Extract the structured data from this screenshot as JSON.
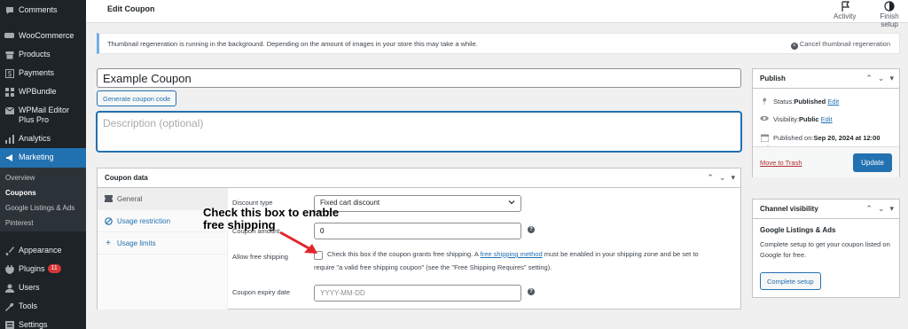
{
  "sidebar": {
    "items": [
      {
        "label": "Comments",
        "icon": "comment-icon"
      },
      {
        "label": "WooCommerce",
        "icon": "woo-icon"
      },
      {
        "label": "Products",
        "icon": "archive-icon"
      },
      {
        "label": "Payments",
        "icon": "dollar-icon"
      },
      {
        "label": "WPBundle",
        "icon": "grid-icon"
      },
      {
        "label": "WPMail Editor Plus Pro",
        "icon": "mail-icon"
      },
      {
        "label": "Analytics",
        "icon": "bar-chart-icon"
      },
      {
        "label": "Marketing",
        "icon": "megaphone-icon"
      },
      {
        "label": "Appearance",
        "icon": "paintbrush-icon"
      },
      {
        "label": "Plugins",
        "icon": "plug-icon",
        "badge": "11"
      },
      {
        "label": "Users",
        "icon": "user-icon"
      },
      {
        "label": "Tools",
        "icon": "wrench-icon"
      },
      {
        "label": "Settings",
        "icon": "settings-icon"
      }
    ],
    "submenu": [
      "Overview",
      "Coupons",
      "Google Listings & Ads",
      "Pinterest"
    ]
  },
  "topbar": {
    "title": "Edit Coupon",
    "activity": "Activity",
    "finish_setup": "Finish setup"
  },
  "notice": {
    "text": "Thumbnail regeneration is running in the background. Depending on the amount of images in your store this may take a while.",
    "cancel": "Cancel thumbnail regeneration"
  },
  "coupon": {
    "title": "Example Coupon",
    "generate_label": "Generate coupon code",
    "description_placeholder": "Description (optional)"
  },
  "coupon_data": {
    "title": "Coupon data",
    "tabs": [
      "General",
      "Usage restriction",
      "Usage limits"
    ],
    "discount_type_label": "Discount type",
    "discount_type_value": "Fixed cart discount",
    "amount_label": "Coupon amount",
    "amount_value": "0",
    "free_shipping_label": "Allow free shipping",
    "free_shipping_desc_pre": "Check this box if the coupon grants free shipping. A ",
    "free_shipping_link": "free shipping method",
    "free_shipping_desc_post": " must be enabled in your shipping zone and be set to",
    "free_shipping_desc_line2": "require \"a valid free shipping coupon\" (see the \"Free Shipping Requires\" setting).",
    "expiry_label": "Coupon expiry date",
    "expiry_placeholder": "YYYY-MM-DD"
  },
  "annotation": {
    "line1": "Check this box to enable",
    "line2": "free shipping",
    "color": "#e3242b"
  },
  "publish": {
    "title": "Publish",
    "status_label": "Status: ",
    "status_value": "Published",
    "visibility_label": "Visibility: ",
    "visibility_value": "Public",
    "published_label": "Published on: ",
    "published_value": "Sep 20, 2024 at 12:00",
    "edit": "Edit",
    "trash": "Move to Trash",
    "update": "Update"
  },
  "channel": {
    "title": "Channel visibility",
    "subtitle": "Google Listings & Ads",
    "desc": "Complete setup to get your coupon listed on Google for free.",
    "button": "Complete setup"
  },
  "colors": {
    "accent": "#2271b1",
    "sidebar_bg": "#1d2327",
    "active_menu": "#2271b1",
    "danger": "#d63638"
  }
}
